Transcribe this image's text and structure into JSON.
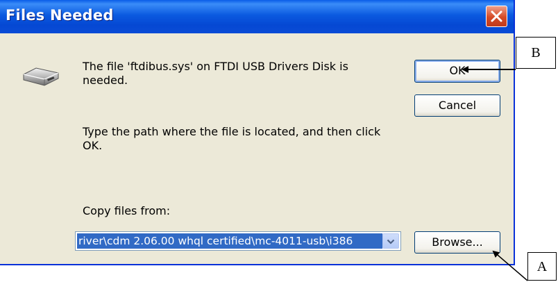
{
  "dialog": {
    "title": "Files Needed",
    "message_line": "The file 'ftdibus.sys' on FTDI USB Drivers Disk is needed.",
    "instruction": "Type the path where the file is located, and then click OK.",
    "copy_label": "Copy files from:",
    "copy_path": "river\\cdm 2.06.00 whql certified\\mc-4011-usb\\i386",
    "buttons": {
      "ok": "OK",
      "cancel": "Cancel",
      "browse": "Browse..."
    }
  },
  "icons": {
    "close": "close-icon",
    "disk": "disk-drive-icon",
    "dropdown": "chevron-down-icon"
  },
  "annotations": {
    "a": "A",
    "b": "B"
  },
  "colors": {
    "titlebar": "#0a5de8",
    "dialog_bg": "#ece9d8",
    "selection": "#316ac5",
    "close": "#d54a25"
  }
}
